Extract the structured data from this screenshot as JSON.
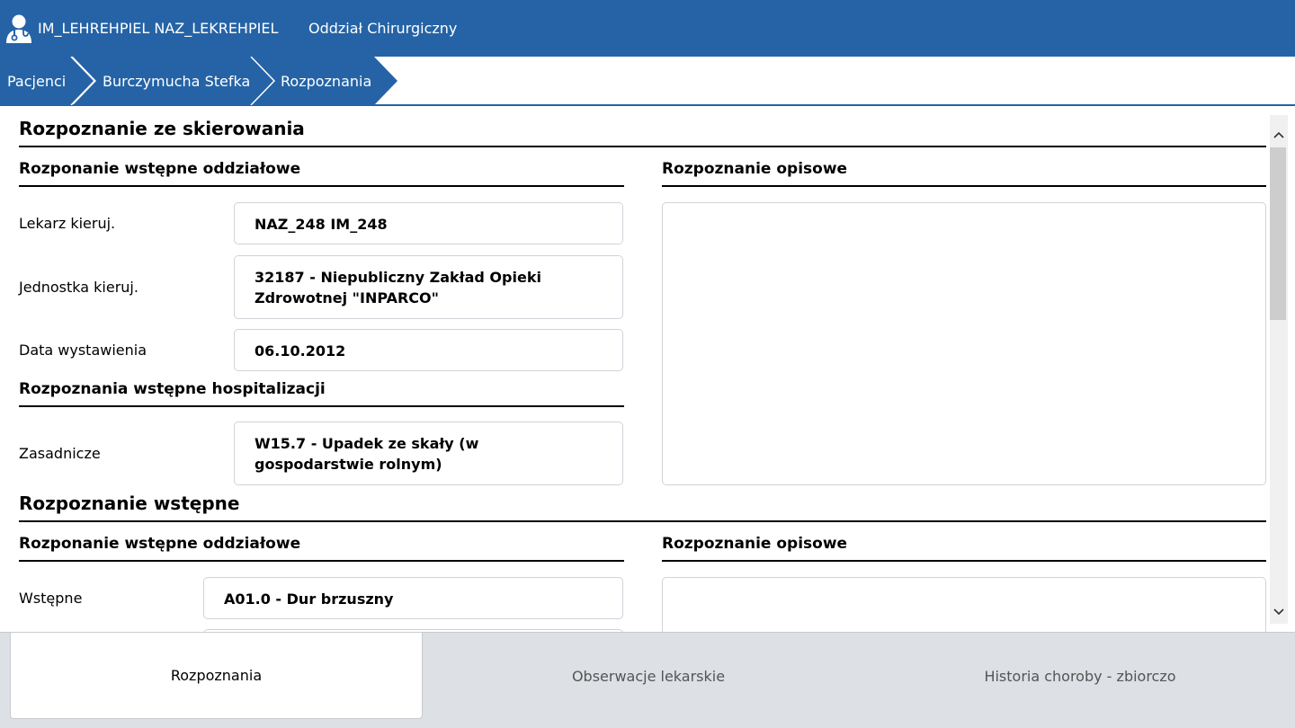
{
  "header": {
    "user_name": "IM_LEHREHPIEL NAZ_LEKREHPIEL",
    "department": "Oddział Chirurgiczny",
    "brand_color": "#2563a6"
  },
  "breadcrumb": [
    "Pacjenci",
    "Burczymucha Stefka",
    "Rozpoznania"
  ],
  "referral": {
    "title": "Rozpoznanie ze skierowania",
    "left_subtitle": "Rozponanie wstępne oddziałowe",
    "right_subtitle": "Rozpoznanie opisowe",
    "fields": [
      {
        "label": "Lekarz kieruj.",
        "value": "NAZ_248 IM_248"
      },
      {
        "label": "Jednostka kieruj.",
        "value": "32187 - Niepubliczny Zakład Opieki Zdrowotnej \"INPARCO\""
      },
      {
        "label": "Data wystawienia",
        "value": "06.10.2012"
      }
    ],
    "hosp_subtitle": "Rozpoznania wstępne hospitalizacji",
    "hosp_fields": [
      {
        "label": "Zasadnicze",
        "value": "W15.7 - Upadek ze skały (w gospodarstwie rolnym)"
      }
    ],
    "description": ""
  },
  "initial": {
    "title": "Rozpoznanie wstępne",
    "left_subtitle": "Rozponanie wstępne oddziałowe",
    "right_subtitle": "Rozpoznanie opisowe",
    "fields": [
      {
        "label": "Wstępne",
        "value": "A01.0 - Dur brzuszny"
      }
    ],
    "description": ""
  },
  "tabs": [
    "Rozpoznania",
    "Obserwacje lekarskie",
    "Historia choroby - zbiorczo"
  ],
  "scrollbar": {
    "up_icon": "chevron-up-icon",
    "down_icon": "chevron-down-icon"
  }
}
